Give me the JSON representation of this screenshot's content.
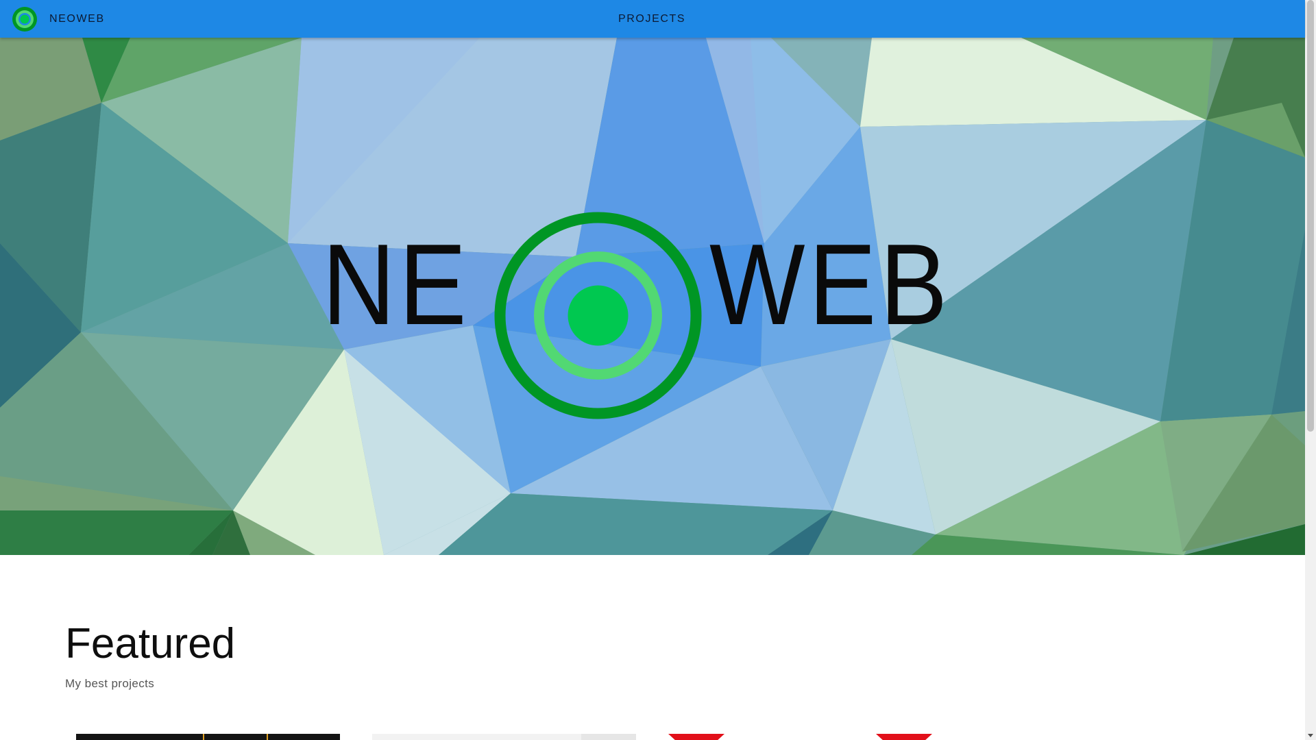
{
  "appbar": {
    "brand": "NEOWEB",
    "logo_icon": "target-logo-icon",
    "nav": [
      {
        "label": "PROJECTS"
      }
    ],
    "color": "#1e88e5"
  },
  "hero": {
    "word_left": "NE",
    "word_right": "WEB",
    "logo_icon": "concentric-target-icon",
    "colors": {
      "ring_outer": "#009624",
      "ring_inner": "#52d873",
      "dot": "#00c850"
    }
  },
  "featured": {
    "title": "Featured",
    "subtitle": "My best projects"
  }
}
